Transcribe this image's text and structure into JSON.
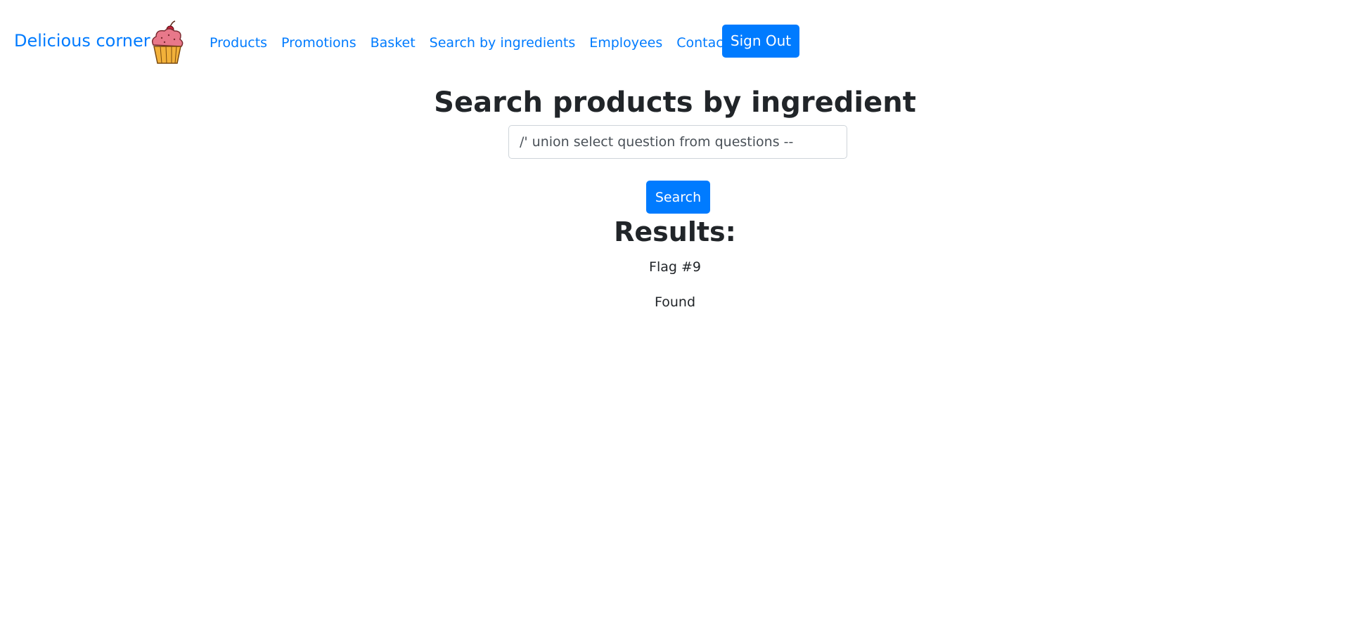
{
  "navbar": {
    "brand": "Delicious corner",
    "links": [
      "Products",
      "Promotions",
      "Basket",
      "Search by ingredients",
      "Employees",
      "Contact us"
    ],
    "signout_label": "Sign Out"
  },
  "search": {
    "title": "Search products by ingredient",
    "input_value": "/' union select question from questions --",
    "button_label": "Search"
  },
  "results": {
    "heading": "Results:",
    "items": [
      "Flag #9",
      "Found"
    ]
  },
  "colors": {
    "accent": "#007bff",
    "text": "#212529"
  }
}
